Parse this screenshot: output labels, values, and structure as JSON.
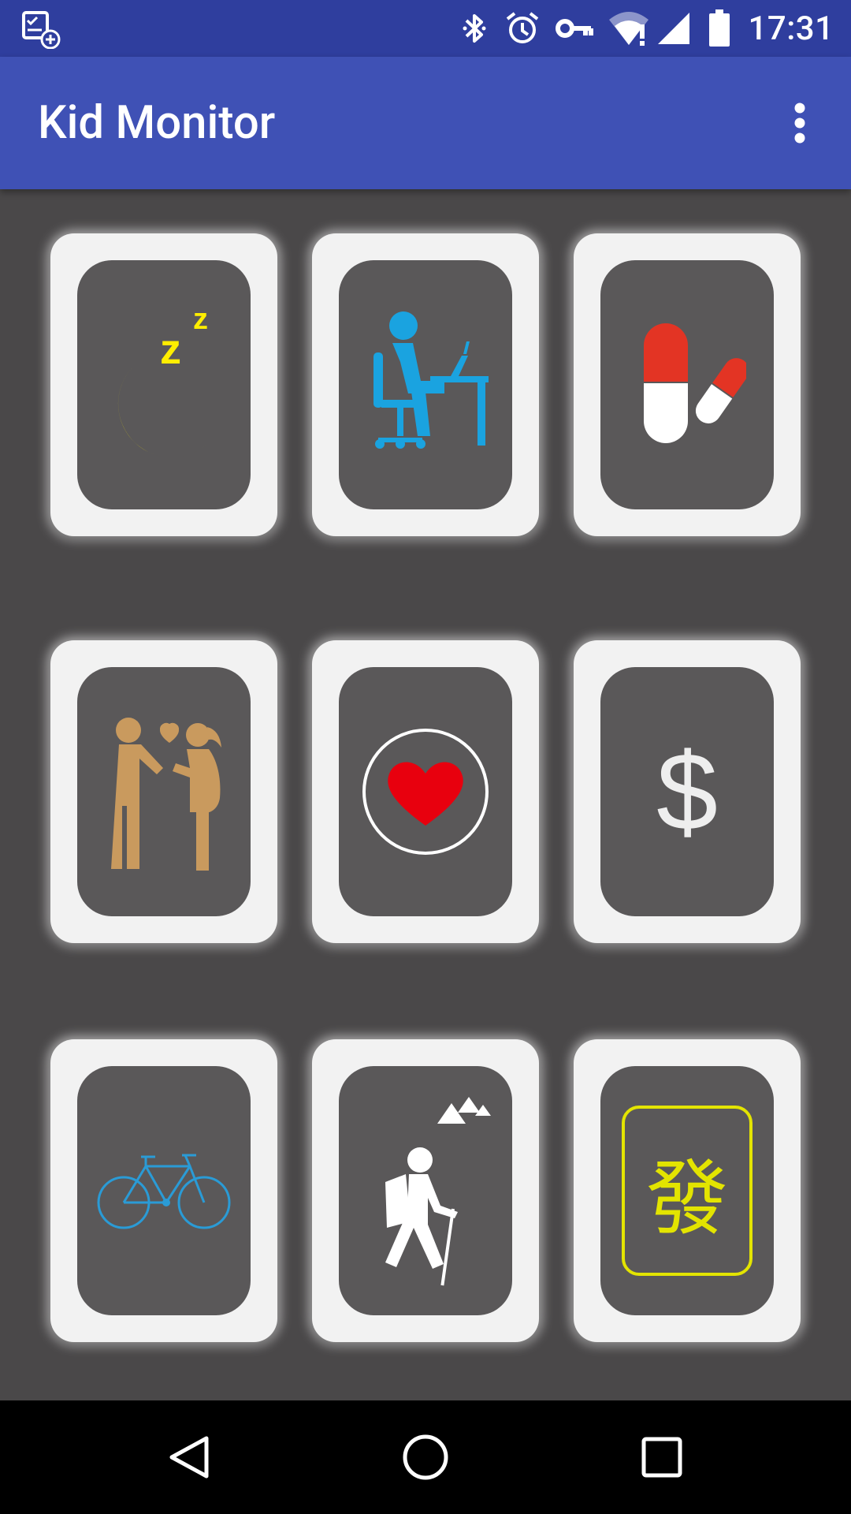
{
  "status_bar": {
    "time": "17:31",
    "icons": [
      "todo-add-notification-icon",
      "bluetooth-icon",
      "alarm-icon",
      "vpn-key-icon",
      "wifi-alert-icon",
      "cell-signal-icon",
      "battery-icon"
    ]
  },
  "app_bar": {
    "title": "Kid Monitor",
    "menu_icon": "more-vert-icon"
  },
  "tiles": [
    {
      "icon": "sleep-icon"
    },
    {
      "icon": "study-icon"
    },
    {
      "icon": "medicine-icon"
    },
    {
      "icon": "relationship-icon"
    },
    {
      "icon": "health-icon"
    },
    {
      "icon": "money-icon",
      "text": "$"
    },
    {
      "icon": "bicycle-icon"
    },
    {
      "icon": "hiking-icon"
    },
    {
      "icon": "mahjong-fa-icon",
      "text": "發"
    }
  ],
  "colors": {
    "status_bar": "#2f3e9e",
    "app_bar": "#3f51b5",
    "background": "#4a4849",
    "tile": "#f2f2f2",
    "tile_inner": "#5a5859",
    "moon": "#ffee00",
    "study": "#1aa3e0",
    "pill_red": "#e33424",
    "couple": "#c99a5e",
    "heart": "#e8000e",
    "bicycle": "#2a9bd6",
    "mahjong": "#e3e400"
  },
  "nav_bar": {
    "buttons": [
      "back-icon",
      "home-icon",
      "recents-icon"
    ]
  }
}
